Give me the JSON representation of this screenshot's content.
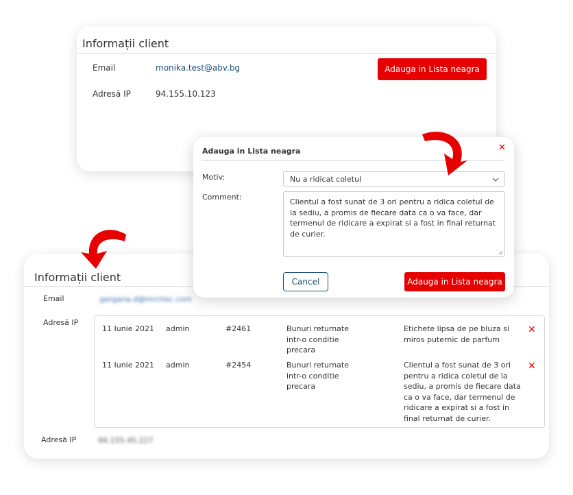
{
  "top_card": {
    "title": "Informații client",
    "email_label": "Email",
    "email_value": "monika.test@abv.bg",
    "ip_label": "Adresă IP",
    "ip_value": "94.155.10.123",
    "blacklist_button": "Adauga in Lista neagra"
  },
  "modal": {
    "title": "Adauga in Lista neagra",
    "motiv_label": "Motiv:",
    "motiv_value": "Nu a ridicat coletul",
    "comment_label": "Comment:",
    "comment_value": "Clientul a fost sunat de 3 ori pentru a ridica coletul de la sediu, a promis de fiecare data ca o va face, dar termenul de ridicare a expirat si a fost in final returnat de curier.",
    "cancel_button": "Cancel",
    "submit_button": "Adauga in Lista neagra"
  },
  "bottom_card": {
    "title": "Informații client",
    "email_label": "Email",
    "email_value": "gergana.d@mrchec.com",
    "history_label": "Adresă IP",
    "ip_label": "Adresă IP",
    "ip_value": "94.155.45.227",
    "history": [
      {
        "date": "11 Iunie 2021",
        "user": "admin",
        "order": "#2461",
        "reason": "Bunuri returnate intr-o conditie precara",
        "comment": "Etichete lipsa de pe bluza si miros puternic de parfum"
      },
      {
        "date": "11 Iunie 2021",
        "user": "admin",
        "order": "#2454",
        "reason": "Bunuri returnate intr-o conditie precara",
        "comment": "Clientul a fost sunat de 3 ori pentru a ridica coletul de la sediu, a promis de fiecare data ca o va face, dar termenul de ridicare a expirat si a fost in final returnat de curier."
      }
    ]
  },
  "colors": {
    "accent_red": "#e60000",
    "link_blue": "#1a5276"
  },
  "icons": {
    "close": "close-icon",
    "dropdown": "chevron-down-icon",
    "delete": "delete-icon",
    "arrow": "curved-arrow-icon"
  }
}
